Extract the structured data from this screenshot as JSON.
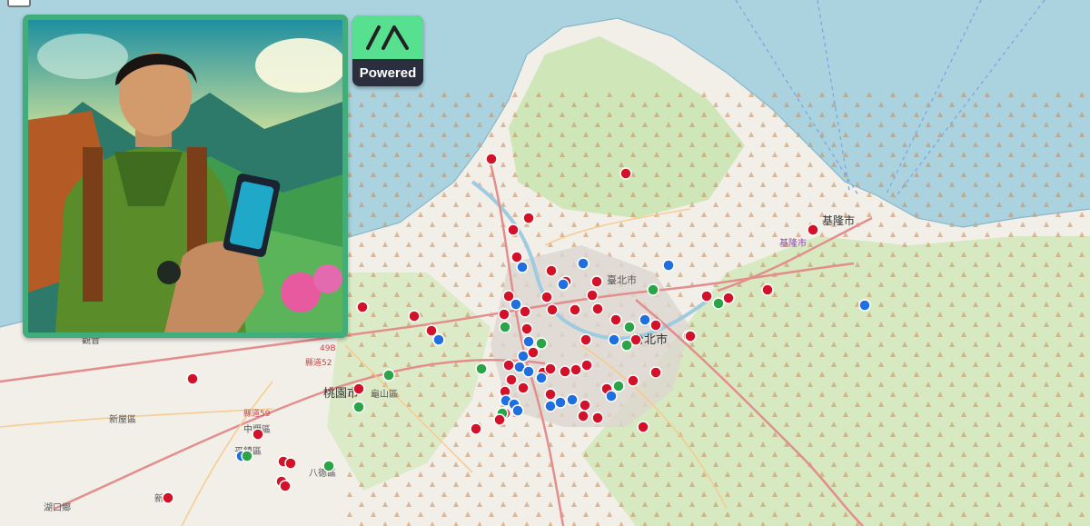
{
  "logo": {
    "caption": "Powered"
  },
  "zoom": {
    "out_label": "−"
  },
  "map": {
    "labels": {
      "taipei": "臺北市",
      "taipei2": "台北市",
      "keelung": "基隆市",
      "keelung2": "基隆市",
      "taoyuan": "桃園市",
      "guishan": "龜山區",
      "zhongli": "中壢區",
      "xinwu": "新屋區",
      "bade": "八德區",
      "pingzhen": "平鎮區",
      "hukou": "湖口鄉",
      "guanyin": "觀音",
      "zhubei": "新竹",
      "road_59": "縣道59",
      "road_52": "縣道52",
      "road_49b": "49B"
    },
    "marker_colors": {
      "red": "#d3122a",
      "blue": "#1f6fe0",
      "green": "#2aa447"
    },
    "colors": {
      "sea": "#aad3df",
      "land": "#f2efe9",
      "forest": "#c8e3b4",
      "mountain": "#dfe7c8"
    }
  }
}
